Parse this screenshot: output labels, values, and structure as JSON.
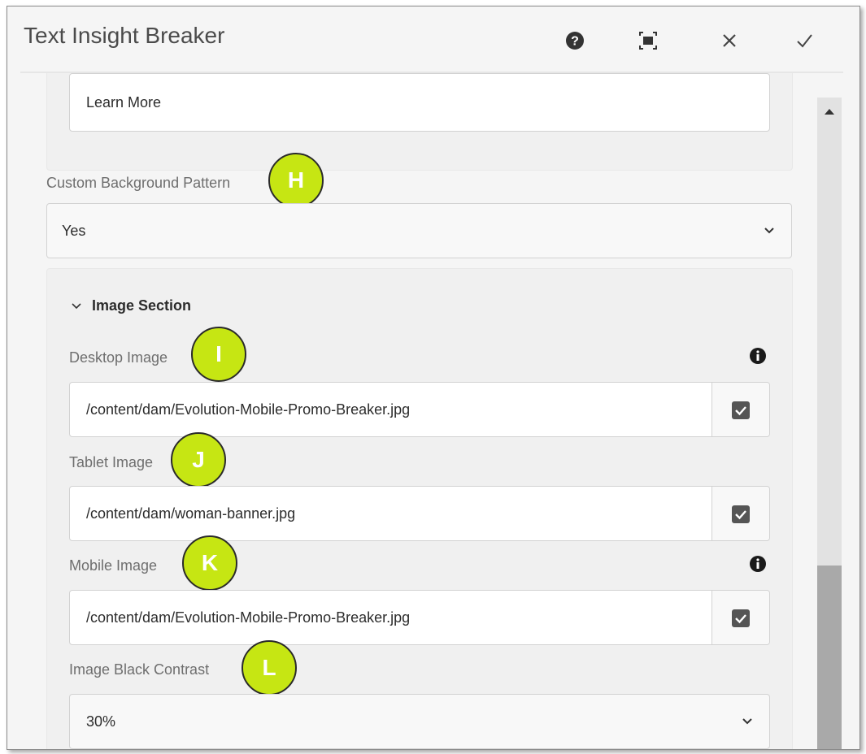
{
  "dialog": {
    "title": "Text Insight Breaker",
    "toolbar": {
      "help_icon": "help-icon",
      "fullscreen_icon": "fullscreen-icon",
      "close_icon": "close-icon",
      "done_icon": "checkmark-icon"
    }
  },
  "form": {
    "learn_more_value": "Learn More",
    "custom_background": {
      "label": "Custom Background Pattern",
      "value": "Yes"
    },
    "image_section": {
      "heading": "Image Section",
      "desktop": {
        "label": "Desktop Image",
        "value": "/content/dam/Evolution-Mobile-Promo-Breaker.jpg"
      },
      "tablet": {
        "label": "Tablet Image",
        "value": "/content/dam/woman-banner.jpg"
      },
      "mobile": {
        "label": "Mobile Image",
        "value": "/content/dam/Evolution-Mobile-Promo-Breaker.jpg"
      },
      "contrast": {
        "label": "Image Black Contrast",
        "value": "30%"
      }
    }
  },
  "badges": {
    "h": "H",
    "i": "I",
    "j": "J",
    "k": "K",
    "l": "L"
  },
  "colors": {
    "badge_fill": "#c6e613",
    "badge_border": "#2a2a2a",
    "dialog_bg": "#f5f5f5"
  }
}
